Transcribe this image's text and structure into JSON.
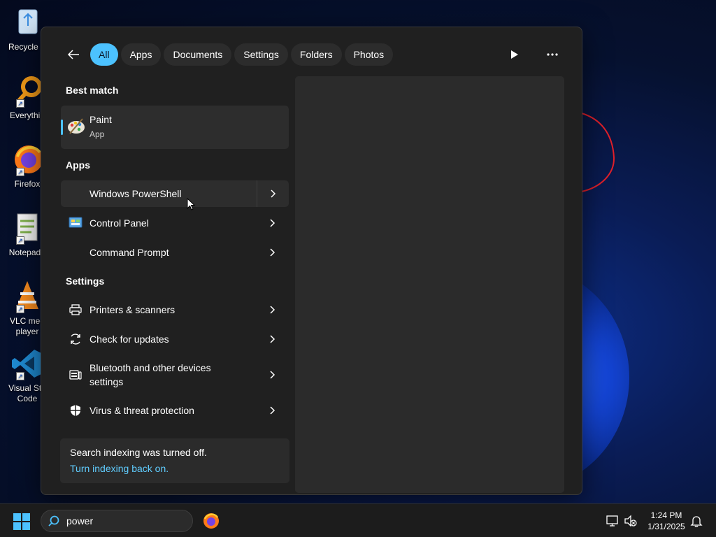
{
  "desktop": {
    "icons": [
      {
        "label": "Recycle B",
        "icon": "recycle-bin-icon"
      },
      {
        "label": "Everythin",
        "icon": "everything-search-icon"
      },
      {
        "label": "Firefox",
        "icon": "firefox-icon"
      },
      {
        "label": "Notepad+",
        "icon": "notepad-plus-plus-icon"
      },
      {
        "label": "VLC med player",
        "icon": "vlc-icon"
      },
      {
        "label": "Visual Stu Code",
        "icon": "vscode-icon"
      }
    ]
  },
  "search_panel": {
    "filters": [
      "All",
      "Apps",
      "Documents",
      "Settings",
      "Folders",
      "Photos"
    ],
    "active_filter": "All",
    "best_match": {
      "heading": "Best match",
      "name": "Paint",
      "kind": "App",
      "icon": "paint-icon"
    },
    "apps": {
      "heading": "Apps",
      "items": [
        {
          "label": "Windows PowerShell",
          "icon": "powershell-icon"
        },
        {
          "label": "Control Panel",
          "icon": "control-panel-icon"
        },
        {
          "label": "Command Prompt",
          "icon": "command-prompt-icon"
        }
      ]
    },
    "settings": {
      "heading": "Settings",
      "items": [
        {
          "label": "Printers & scanners",
          "icon": "printer-icon"
        },
        {
          "label": "Check for updates",
          "icon": "refresh-icon"
        },
        {
          "label": "Bluetooth and other devices settings",
          "icon": "devices-icon"
        },
        {
          "label": "Virus & threat protection",
          "icon": "shield-icon"
        }
      ]
    },
    "indexing": {
      "message": "Search indexing was turned off.",
      "link": "Turn indexing back on."
    }
  },
  "taskbar": {
    "search_value": "power",
    "time": "1:24 PM",
    "date": "1/31/2025"
  },
  "colors": {
    "accent": "#4cc2ff",
    "link": "#60cdff",
    "panel_bg": "#202020",
    "card_bg": "#2d2d2d"
  }
}
